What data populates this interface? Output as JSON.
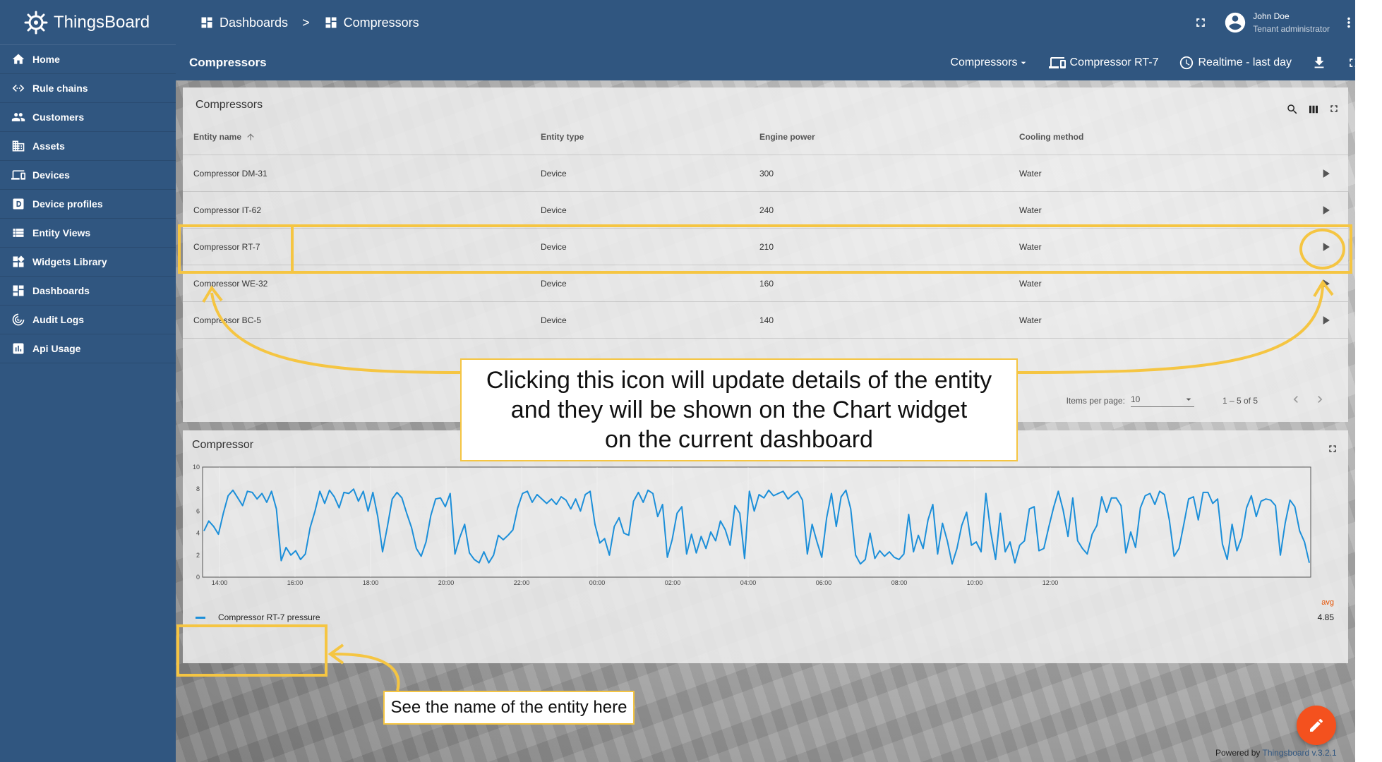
{
  "app": {
    "name": "ThingsBoard"
  },
  "sidebar": {
    "items": [
      {
        "label": "Home",
        "icon": "home-icon"
      },
      {
        "label": "Rule chains",
        "icon": "code-icon"
      },
      {
        "label": "Customers",
        "icon": "people-icon"
      },
      {
        "label": "Assets",
        "icon": "building-icon"
      },
      {
        "label": "Devices",
        "icon": "devices-icon"
      },
      {
        "label": "Device profiles",
        "icon": "profile-icon"
      },
      {
        "label": "Entity Views",
        "icon": "view-list-icon"
      },
      {
        "label": "Widgets Library",
        "icon": "widgets-icon"
      },
      {
        "label": "Dashboards",
        "icon": "dashboard-icon"
      },
      {
        "label": "Audit Logs",
        "icon": "track-icon"
      },
      {
        "label": "Api Usage",
        "icon": "chart-icon"
      }
    ]
  },
  "breadcrumb": {
    "first": "Dashboards",
    "separator": ">",
    "second": "Compressors"
  },
  "user": {
    "name": "John Doe",
    "role": "Tenant administrator"
  },
  "dashboard": {
    "title": "Compressors",
    "state_select": "Compressors",
    "entity": "Compressor RT-7",
    "timewindow": "Realtime - last day"
  },
  "table": {
    "title": "Compressors",
    "columns": [
      "Entity name",
      "Entity type",
      "Engine power",
      "Cooling method"
    ],
    "rows": [
      [
        "Compressor DM-31",
        "Device",
        "300",
        "Water"
      ],
      [
        "Compressor IT-62",
        "Device",
        "240",
        "Water"
      ],
      [
        "Compressor RT-7",
        "Device",
        "210",
        "Water"
      ],
      [
        "Compressor WE-32",
        "Device",
        "160",
        "Water"
      ],
      [
        "Compressor BC-5",
        "Device",
        "140",
        "Water"
      ]
    ],
    "pager": {
      "label": "Items per page:",
      "page_size": "10",
      "range": "1 – 5 of 5"
    }
  },
  "chart_widget": {
    "title": "Compressor",
    "legend_label": "Compressor RT-7 pressure",
    "avg_header": "avg",
    "avg_value": "4.85"
  },
  "chart_data": {
    "type": "line",
    "x_ticks": [
      "14:00",
      "16:00",
      "18:00",
      "20:00",
      "22:00",
      "00:00",
      "02:00",
      "04:00",
      "06:00",
      "08:00",
      "10:00",
      "12:00"
    ],
    "y_ticks": [
      "0",
      "2",
      "4",
      "6",
      "8",
      "10"
    ],
    "ylim": [
      0,
      10
    ],
    "series": [
      {
        "name": "Compressor RT-7 pressure",
        "color": "#1c8fd9",
        "values": [
          4.2,
          5.1,
          4.6,
          3.9,
          5.8,
          7.4,
          7.9,
          7.2,
          6.5,
          7.8,
          7.7,
          7.1,
          7.6,
          6.8,
          7.8,
          6.2,
          1.5,
          2.7,
          2.0,
          2.4,
          1.6,
          2.1,
          4.5,
          6.0,
          7.8,
          6.7,
          7.9,
          7.3,
          6.3,
          7.7,
          7.6,
          8.0,
          6.9,
          7.8,
          6.0,
          7.7,
          5.5,
          2.3,
          4.6,
          7.1,
          7.7,
          7.2,
          5.8,
          4.5,
          2.6,
          1.9,
          3.2,
          5.6,
          7.1,
          7.2,
          6.4,
          7.6,
          2.1,
          3.6,
          4.8,
          2.2,
          1.6,
          1.3,
          2.3,
          1.3,
          2.0,
          3.8,
          3.4,
          3.8,
          4.3,
          6.3,
          7.6,
          7.8,
          6.8,
          7.5,
          7.1,
          6.7,
          7.1,
          6.6,
          7.3,
          7.0,
          6.2,
          7.1,
          6.0,
          7.5,
          7.8,
          4.8,
          3.1,
          3.5,
          2.0,
          4.6,
          5.4,
          4.0,
          3.8,
          6.9,
          7.7,
          6.8,
          7.9,
          7.6,
          5.5,
          6.6,
          1.8,
          3.4,
          5.8,
          6.4,
          2.1,
          3.9,
          2.2,
          3.7,
          2.6,
          4.1,
          3.3,
          5.1,
          4.3,
          2.9,
          6.5,
          5.8,
          1.7,
          7.8,
          6.0,
          7.5,
          7.2,
          7.9,
          7.4,
          7.6,
          7.8,
          7.1,
          7.5,
          7.8,
          7.0,
          2.1,
          4.8,
          3.2,
          1.8,
          5.4,
          7.6,
          4.6,
          7.3,
          7.9,
          6.2,
          2.0,
          1.2,
          1.6,
          4.0,
          1.7,
          2.4,
          1.9,
          2.3,
          1.8,
          1.6,
          2.1,
          5.7,
          2.3,
          3.8,
          2.6,
          5.2,
          6.6,
          2.1,
          4.9,
          3.3,
          1.2,
          2.6,
          4.7,
          5.9,
          2.9,
          3.2,
          2.3,
          7.6,
          4.1,
          1.6,
          5.8,
          2.3,
          3.2,
          1.3,
          2.9,
          3.3,
          6.2,
          6.4,
          2.4,
          2.6,
          4.5,
          6.3,
          7.8,
          6.1,
          3.7,
          7.2,
          3.3,
          2.6,
          2.1,
          3.9,
          4.7,
          7.3,
          5.9,
          7.2,
          7.2,
          6.5,
          2.2,
          4.1,
          2.7,
          6.3,
          7.4,
          7.6,
          6.6,
          7.8,
          7.5,
          5.2,
          1.9,
          2.6,
          4.8,
          7.1,
          7.3,
          5.2,
          7.7,
          7.7,
          6.7,
          7.1,
          3.0,
          1.6,
          4.8,
          2.4,
          3.6,
          6.3,
          7.4,
          5.5,
          6.9,
          7.1,
          7.0,
          6.5,
          2.0,
          4.9,
          7.0,
          6.4,
          4.2,
          3.2,
          1.3
        ]
      }
    ]
  },
  "annotations": {
    "main": [
      "Clicking this icon will update details of the entity",
      "and they will be shown on the Chart widget",
      "on the current dashboard"
    ],
    "name": "See the name of the entity here"
  },
  "footer": {
    "powered_by": "Powered by",
    "version": "Thingsboard v.3.2.1"
  },
  "colors": {
    "primary": "#305680",
    "accent": "#f5c542",
    "fab": "#f4511e",
    "line": "#1c8fd9"
  }
}
